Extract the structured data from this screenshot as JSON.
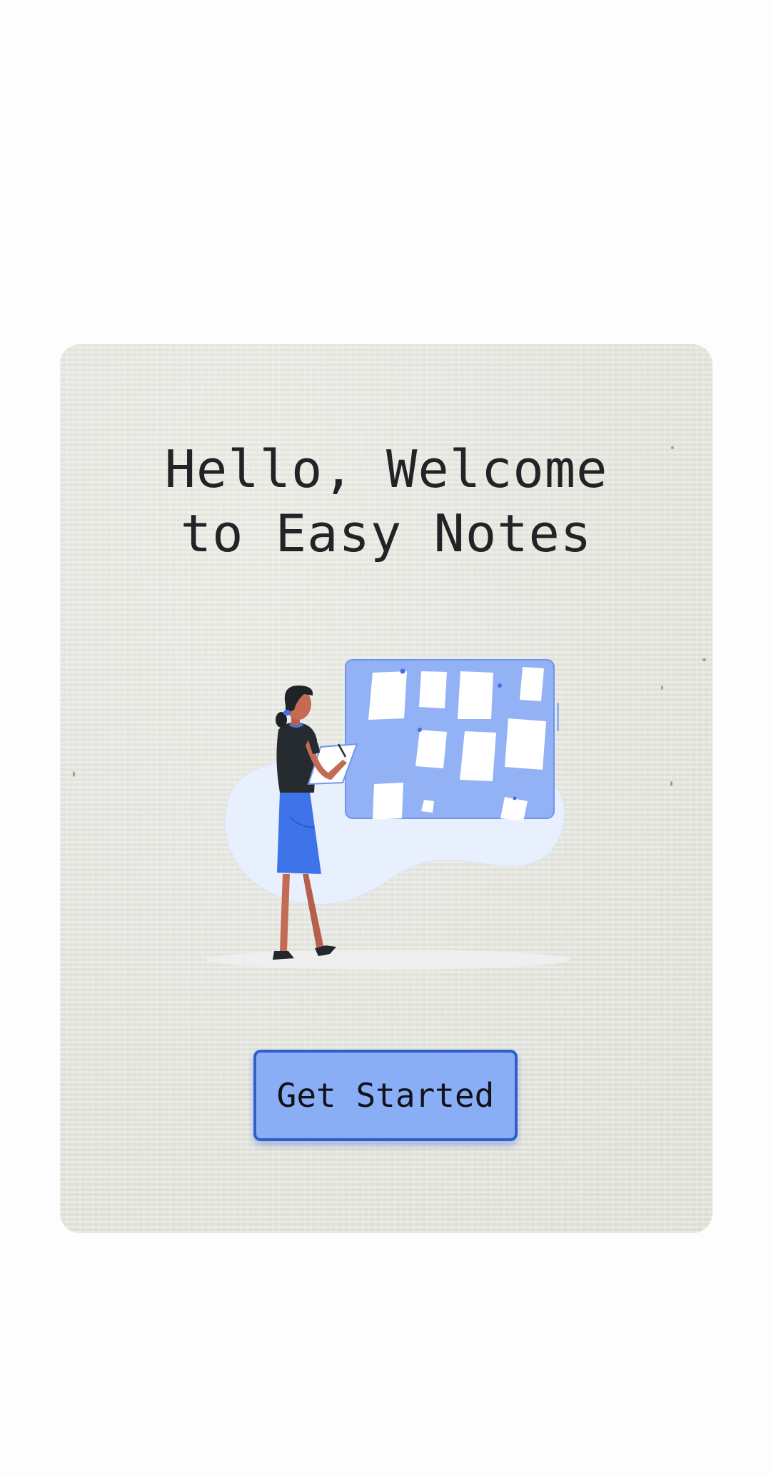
{
  "welcome": {
    "title_line1": "Hello, Welcome",
    "title_line2": "to Easy Notes",
    "illustration_icon": "woman-pinning-notes-board-illustration",
    "get_started_label": "Get Started"
  },
  "colors": {
    "card_background": "#e8e9e2",
    "button_fill": "#8aaef6",
    "button_border": "#2f5fcf",
    "board_blue": "#93b1f5",
    "accent_blue": "#4477ee",
    "text_dark": "#222326"
  }
}
